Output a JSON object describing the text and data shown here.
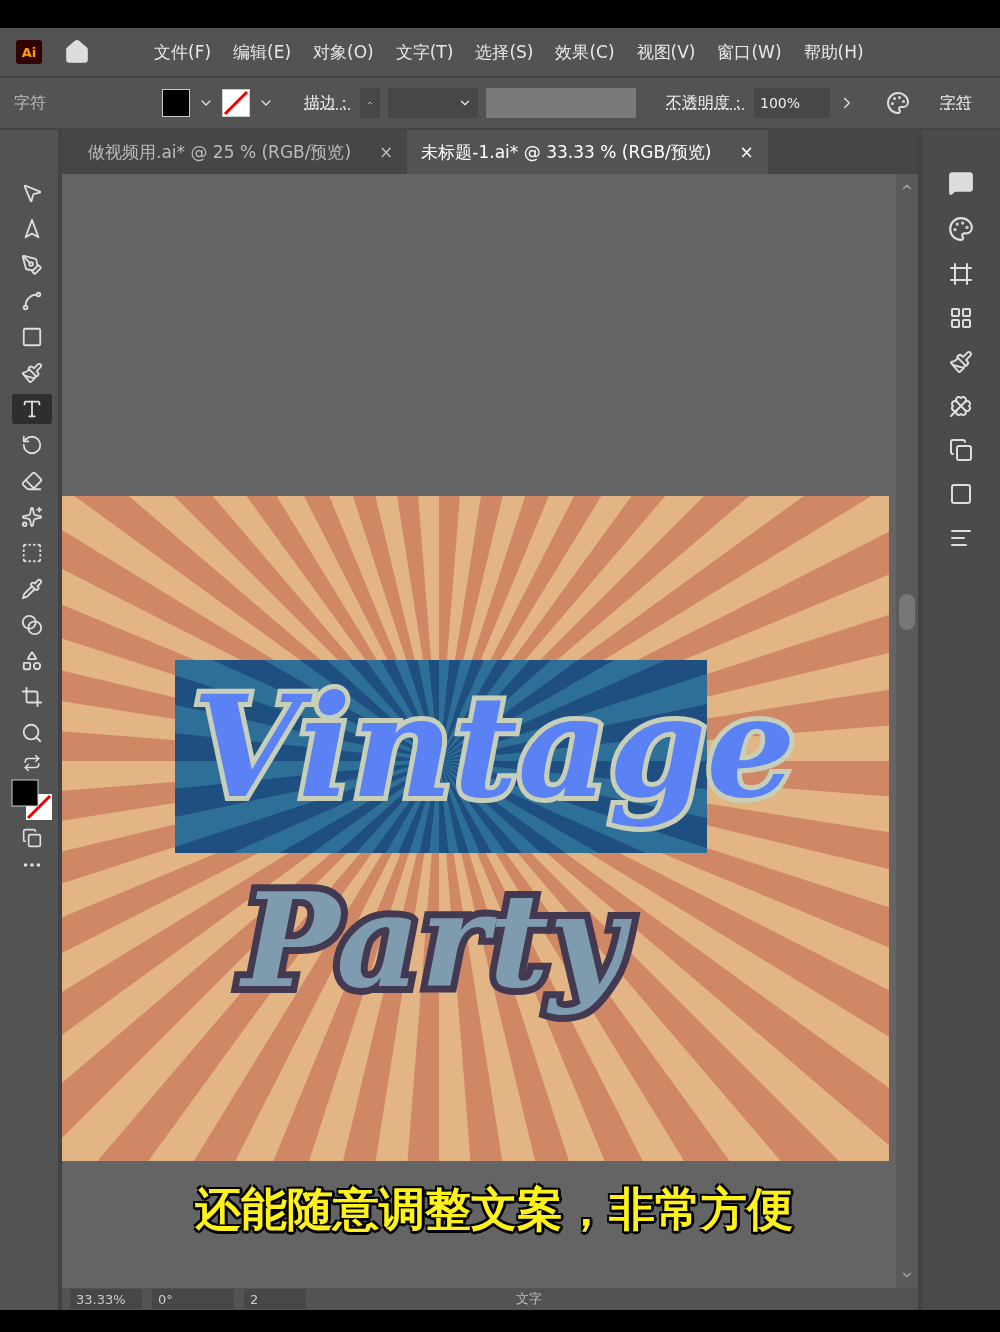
{
  "app": {
    "logo": "Ai"
  },
  "menu": [
    "文件(F)",
    "编辑(E)",
    "对象(O)",
    "文字(T)",
    "选择(S)",
    "效果(C)",
    "视图(V)",
    "窗口(W)",
    "帮助(H)"
  ],
  "control_bar": {
    "panel_label": "字符",
    "stroke_label": "描边：",
    "opacity_label": "不透明度：",
    "opacity_value": "100%",
    "character_link": "字符"
  },
  "tabs": [
    {
      "label": "做视频用.ai* @ 25 % (RGB/预览)",
      "close": "×",
      "selected": false
    },
    {
      "label": "未标题-1.ai* @ 33.33 % (RGB/预览)",
      "close": "×",
      "selected": true
    }
  ],
  "tools": [
    {
      "kind": "selection",
      "selected": false
    },
    {
      "kind": "direct",
      "selected": false
    },
    {
      "kind": "pen",
      "selected": false
    },
    {
      "kind": "curvature",
      "selected": false
    },
    {
      "kind": "rectangle",
      "selected": false
    },
    {
      "kind": "brush",
      "selected": false
    },
    {
      "kind": "type",
      "selected": true
    },
    {
      "kind": "rotate",
      "selected": false
    },
    {
      "kind": "eraser",
      "selected": false
    },
    {
      "kind": "warp",
      "selected": false
    },
    {
      "kind": "gradient",
      "selected": false
    },
    {
      "kind": "eyedropper",
      "selected": false
    },
    {
      "kind": "blend",
      "selected": false
    },
    {
      "kind": "shapebuilder",
      "selected": false
    },
    {
      "kind": "artboard",
      "selected": false
    },
    {
      "kind": "zoom",
      "selected": false
    }
  ],
  "artwork": {
    "line_1": "Vintage",
    "line_2": "Party"
  },
  "subtitle": "还能随意调整文案，非常方便",
  "status_bar": {
    "zoom": "33.33%",
    "rotation": "0°",
    "artboard": "2",
    "tool": "文字"
  }
}
